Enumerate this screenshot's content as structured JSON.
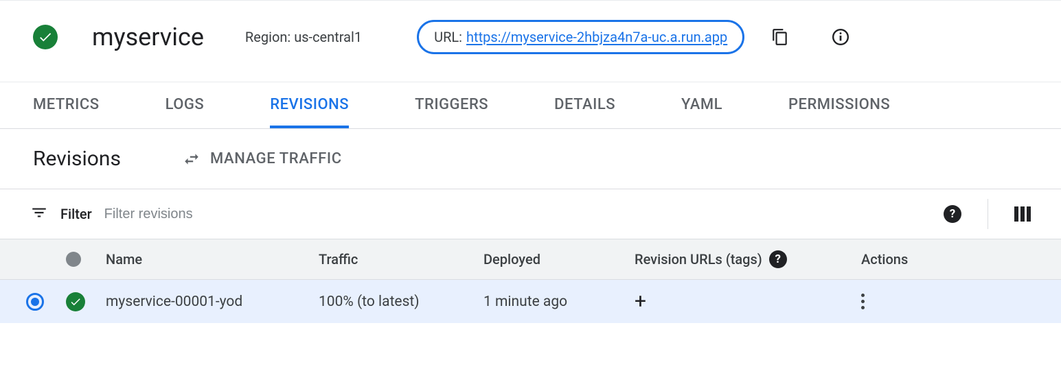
{
  "header": {
    "service_name": "myservice",
    "region_label": "Region: us-central1",
    "url_prefix": "URL:",
    "url": "https://myservice-2hbjza4n7a-uc.a.run.app"
  },
  "tabs": [
    {
      "label": "METRICS",
      "active": false
    },
    {
      "label": "LOGS",
      "active": false
    },
    {
      "label": "REVISIONS",
      "active": true
    },
    {
      "label": "TRIGGERS",
      "active": false
    },
    {
      "label": "DETAILS",
      "active": false
    },
    {
      "label": "YAML",
      "active": false
    },
    {
      "label": "PERMISSIONS",
      "active": false
    }
  ],
  "section": {
    "title": "Revisions",
    "manage_traffic": "MANAGE TRAFFIC"
  },
  "filter": {
    "label": "Filter",
    "placeholder": "Filter revisions"
  },
  "table": {
    "headers": {
      "name": "Name",
      "traffic": "Traffic",
      "deployed": "Deployed",
      "urls": "Revision URLs (tags)",
      "actions": "Actions"
    },
    "rows": [
      {
        "selected": true,
        "status": "ok",
        "name": "myservice-00001-yod",
        "traffic": "100% (to latest)",
        "deployed": "1 minute ago"
      }
    ]
  }
}
